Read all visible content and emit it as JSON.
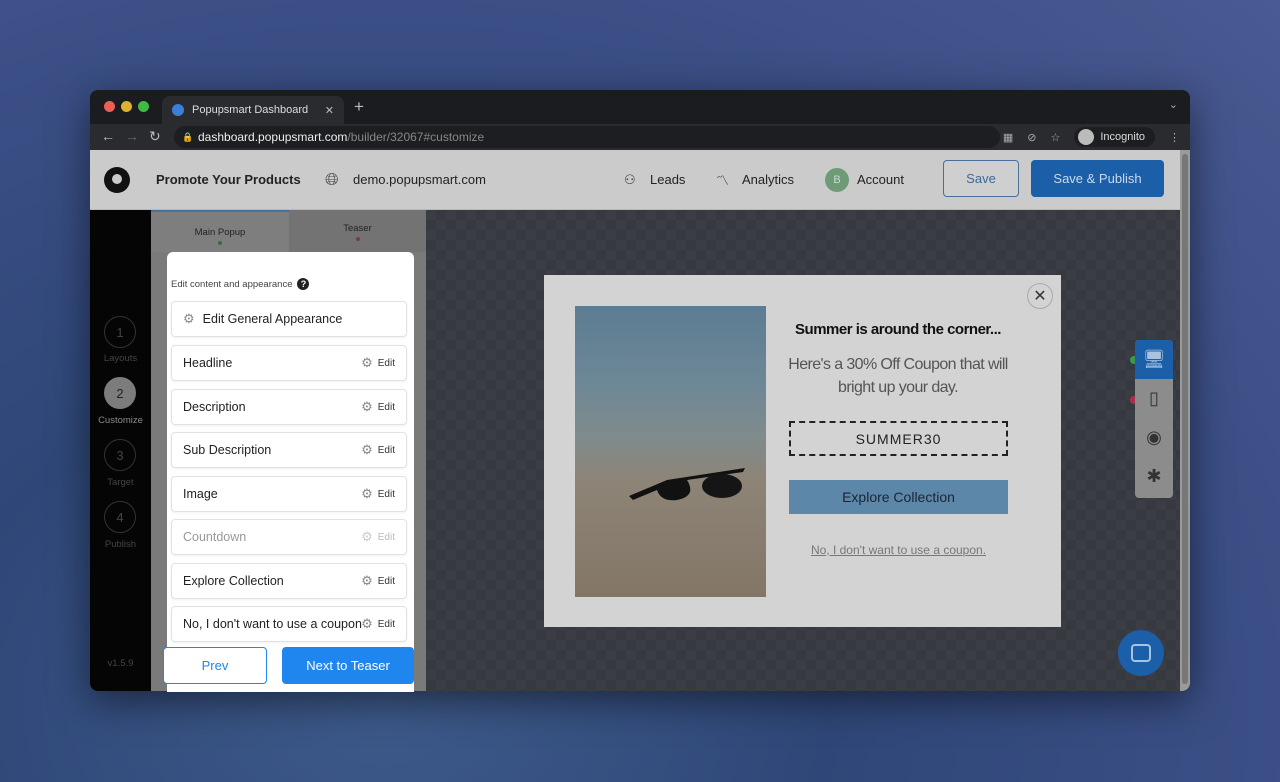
{
  "browser": {
    "tab_title": "Popupsmart Dashboard",
    "url_host": "dashboard.popupsmart.com",
    "url_path": "/builder/32067#customize",
    "incognito_label": "Incognito"
  },
  "header": {
    "campaign_name": "Promote Your Products",
    "site": "demo.popupsmart.com",
    "nav": [
      {
        "label": "Leads",
        "icon": "users-icon"
      },
      {
        "label": "Analytics",
        "icon": "trend-icon"
      },
      {
        "label": "Account",
        "icon": "avatar",
        "avatar_letter": "B"
      }
    ],
    "save_label": "Save",
    "publish_label": "Save & Publish"
  },
  "steps": [
    {
      "num": "1",
      "label": "Layouts"
    },
    {
      "num": "2",
      "label": "Customize",
      "active": true
    },
    {
      "num": "3",
      "label": "Target"
    },
    {
      "num": "4",
      "label": "Publish"
    }
  ],
  "version": "v1.5.9",
  "panel": {
    "tabs": [
      {
        "label": "Main Popup",
        "status_color": "#3a9a4a"
      },
      {
        "label": "Teaser",
        "status_color": "#c0394a"
      }
    ],
    "hint": "Edit content and appearance",
    "general": "Edit General Appearance",
    "edit_label": "Edit",
    "items": [
      {
        "label": "Headline"
      },
      {
        "label": "Description"
      },
      {
        "label": "Sub Description"
      },
      {
        "label": "Image"
      },
      {
        "label": "Countdown",
        "disabled": true
      },
      {
        "label": "Explore Collection"
      },
      {
        "label": "No, I don't want to use a coupon"
      }
    ],
    "prev_label": "Prev",
    "next_label": "Next to Teaser"
  },
  "popup": {
    "headline": "Summer is around the corner...",
    "description": "Here's a 30% Off Coupon that will bright up your day.",
    "coupon": "SUMMER30",
    "cta": "Explore Collection",
    "decline": "No, I don't want to use a coupon."
  },
  "colors": {
    "accent": "#1f86f0",
    "cta": "#5c87a8"
  }
}
